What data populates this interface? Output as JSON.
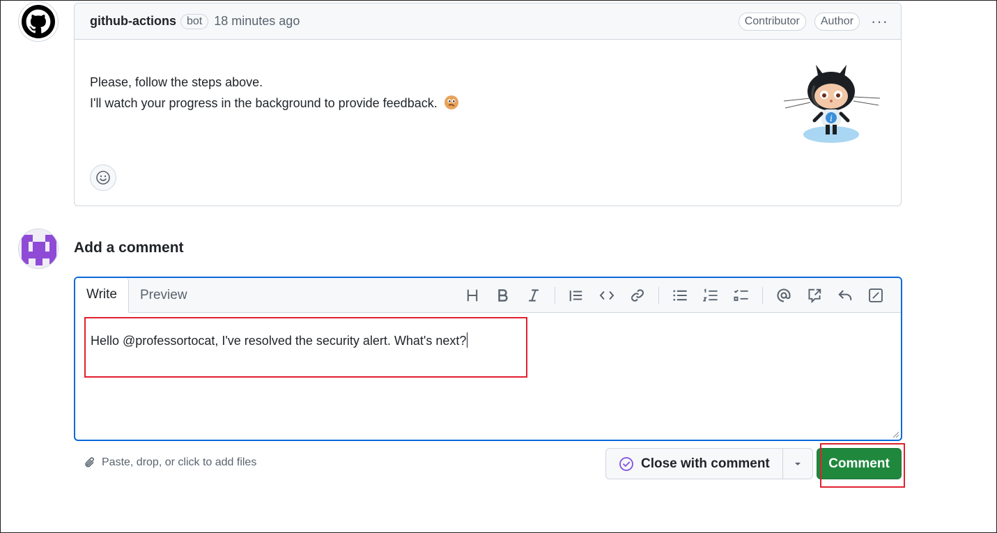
{
  "bot_comment": {
    "author": "github-actions",
    "badge": "bot",
    "timestamp": "18 minutes ago",
    "roles": [
      "Contributor",
      "Author"
    ],
    "more_label": "···",
    "lines": [
      "Please, follow the steps above.",
      "I'll watch your progress in the background to provide feedback."
    ],
    "thinking_emoji": "🤔"
  },
  "new_comment": {
    "title": "Add a comment",
    "tabs": [
      "Write",
      "Preview"
    ],
    "text": "Hello @professortocat, I've resolved the security alert. What's next?",
    "attach_hint": "Paste, drop, or click to add files",
    "close_label": "Close with comment",
    "submit_label": "Comment"
  },
  "toolbar_icons": [
    "heading-icon",
    "bold-icon",
    "italic-icon",
    "quote-icon",
    "code-icon",
    "link-icon",
    "unordered-list-icon",
    "ordered-list-icon",
    "task-list-icon",
    "mention-icon",
    "cross-reference-icon",
    "saved-reply-icon",
    "fullscreen-icon"
  ],
  "colors": {
    "accent_blue": "#0969da",
    "success_green": "#1f883d",
    "highlight_red": "#e0202e",
    "close_purple": "#8250df"
  }
}
